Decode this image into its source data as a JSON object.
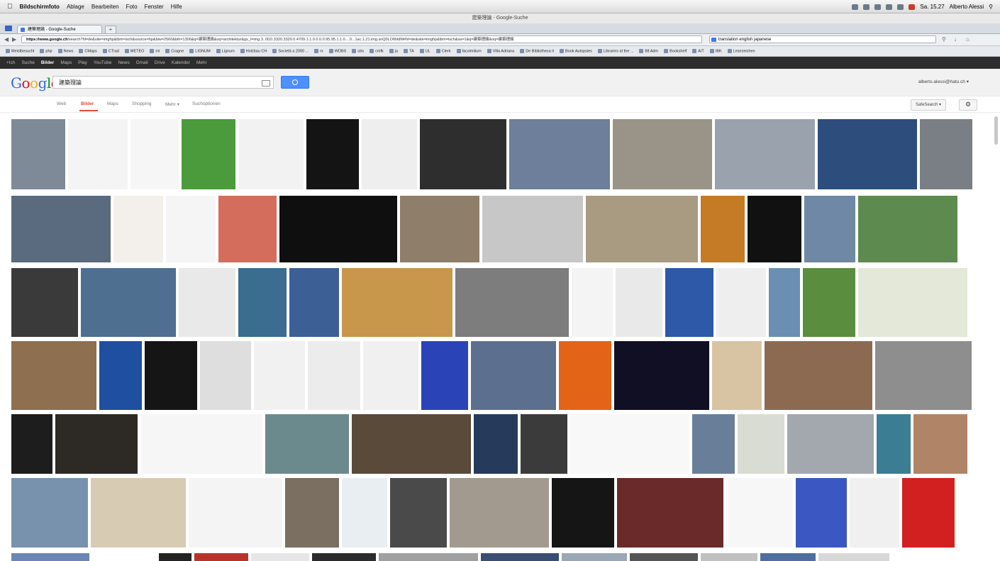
{
  "menubar": {
    "app": "Bildschirmfoto",
    "items": [
      "Ablage",
      "Bearbeiten",
      "Foto",
      "Fenster",
      "Hilfe"
    ],
    "clock": "Sa. 15.27",
    "user": "Alberto Alessi"
  },
  "window": {
    "title": "建築理論 - Google-Suche"
  },
  "tab": {
    "label": "建築理論 - Google-Suche",
    "new": "+"
  },
  "nav": {
    "url_host": "https://www.google.ch",
    "url_path": "/search?hl=de&site=imghp&tbm=isch&source=hp&biw=2560&bih=1306&q=建築理論&oq=architektur&gs_l=img.3..0l10.3320.3320.0.4709.1.1.0.0.0.0.95.95.1.1.0....0...1ac.1.21.img.soQ0LO6hldM#hl=de&site=imghp&tbm=isch&sa=1&q=建築理論&oq=建築理論",
    "search_field": "translation english japanese"
  },
  "bookmarks": [
    "Meistbesucht",
    "php",
    "News",
    "CMaps",
    "CTrad",
    "METEO",
    "mi",
    "Cragne",
    "LIGNUM",
    "Lignum",
    "Holzbau CH",
    "Società a 2000 ...",
    "rx",
    "WDBS",
    "ubs",
    "cmfk",
    "ja",
    "TA",
    "UL",
    "Clerk",
    "facsimilium",
    "Villa Adriana",
    "De Bibliotheca it",
    "Book Autopsies",
    "Libraries at the ...",
    "88 Adm",
    "Bookshelf",
    "A/T",
    "IBK",
    "Lesezeichen"
  ],
  "gbar": [
    "+Ich",
    "Suche",
    "Bilder",
    "Maps",
    "Play",
    "YouTube",
    "News",
    "Gmail",
    "Drive",
    "Kalender",
    "Mehr"
  ],
  "gbar_active": "Bilder",
  "search": {
    "query": "建築理論",
    "user": "alberto.alessi@hatu.ch"
  },
  "toolbar": {
    "web": "Web",
    "images": "Bilder",
    "maps": "Maps",
    "shopping": "Shopping",
    "more": "Mehr",
    "tools": "Suchoptionen",
    "safe": "SafeSearch"
  },
  "image_rows": [
    [
      {
        "c": "#7e8a97"
      },
      {
        "c": "#f4f4f4"
      },
      {
        "c": "#f6f6f6"
      },
      {
        "c": "#4b9a3c"
      },
      {
        "c": "#f2f2f2"
      },
      {
        "c": "#141414"
      },
      {
        "c": "#eeeeee"
      },
      {
        "c": "#2e2e2e"
      },
      {
        "c": "#6d7f9a"
      },
      {
        "c": "#9a9488"
      },
      {
        "c": "#9aa3ad"
      },
      {
        "c": "#2d4d7d"
      },
      {
        "c": "#7a7f86"
      }
    ],
    [
      {
        "c": "#5a6b7f"
      },
      {
        "c": "#f3f0ec"
      },
      {
        "c": "#f5f5f5"
      },
      {
        "c": "#d46d5b"
      },
      {
        "c": "#0f0f0f"
      },
      {
        "c": "#8f7e6a"
      },
      {
        "c": "#c7c7c7"
      },
      {
        "c": "#a99a82"
      },
      {
        "c": "#c57a25"
      },
      {
        "c": "#111111"
      },
      {
        "c": "#6e88a5"
      },
      {
        "c": "#5d8a4e"
      }
    ],
    [
      {
        "c": "#3a3a3a"
      },
      {
        "c": "#4f6f91"
      },
      {
        "c": "#e9e9e9"
      },
      {
        "c": "#3a6d8f"
      },
      {
        "c": "#3c5f96"
      },
      {
        "c": "#c8974b"
      },
      {
        "c": "#7d7d7d"
      },
      {
        "c": "#f4f4f4"
      },
      {
        "c": "#e9e9e9"
      },
      {
        "c": "#2e58a8"
      },
      {
        "c": "#eeeeee"
      },
      {
        "c": "#6a8fb2"
      },
      {
        "c": "#5b8d3f"
      },
      {
        "c": "#e4e8d8"
      }
    ],
    [
      {
        "c": "#8e6f4f"
      },
      {
        "c": "#1f4fa0"
      },
      {
        "c": "#151515"
      },
      {
        "c": "#dedede"
      },
      {
        "c": "#f1f1f1"
      },
      {
        "c": "#ececec"
      },
      {
        "c": "#f0f0f0"
      },
      {
        "c": "#2a44b8"
      },
      {
        "c": "#5d6f8f"
      },
      {
        "c": "#e46417"
      },
      {
        "c": "#110f24"
      },
      {
        "c": "#d8c4a3"
      },
      {
        "c": "#8c6a52"
      },
      {
        "c": "#8e8e8e"
      }
    ],
    [
      {
        "c": "#1d1d1d"
      },
      {
        "c": "#2d2a25"
      },
      {
        "c": "#f6f6f6"
      },
      {
        "c": "#6b8a8e"
      },
      {
        "c": "#5a4a3a"
      },
      {
        "c": "#263a5c"
      },
      {
        "c": "#3b3b3b"
      },
      {
        "c": "#f8f8f8"
      },
      {
        "c": "#697f99"
      },
      {
        "c": "#d9dcd2"
      },
      {
        "c": "#a3a8ae"
      },
      {
        "c": "#3b7d93"
      },
      {
        "c": "#b08466"
      }
    ],
    [
      {
        "c": "#7892ad"
      },
      {
        "c": "#d8cbb3"
      },
      {
        "c": "#f4f4f4"
      },
      {
        "c": "#7a6f61"
      },
      {
        "c": "#e9eef2"
      },
      {
        "c": "#4a4a4a"
      },
      {
        "c": "#a29a8e"
      },
      {
        "c": "#151515"
      },
      {
        "c": "#6a2a2a"
      },
      {
        "c": "#f7f7f7"
      },
      {
        "c": "#3b58c2"
      },
      {
        "c": "#f0f0f0"
      },
      {
        "c": "#d21f1f"
      }
    ]
  ]
}
